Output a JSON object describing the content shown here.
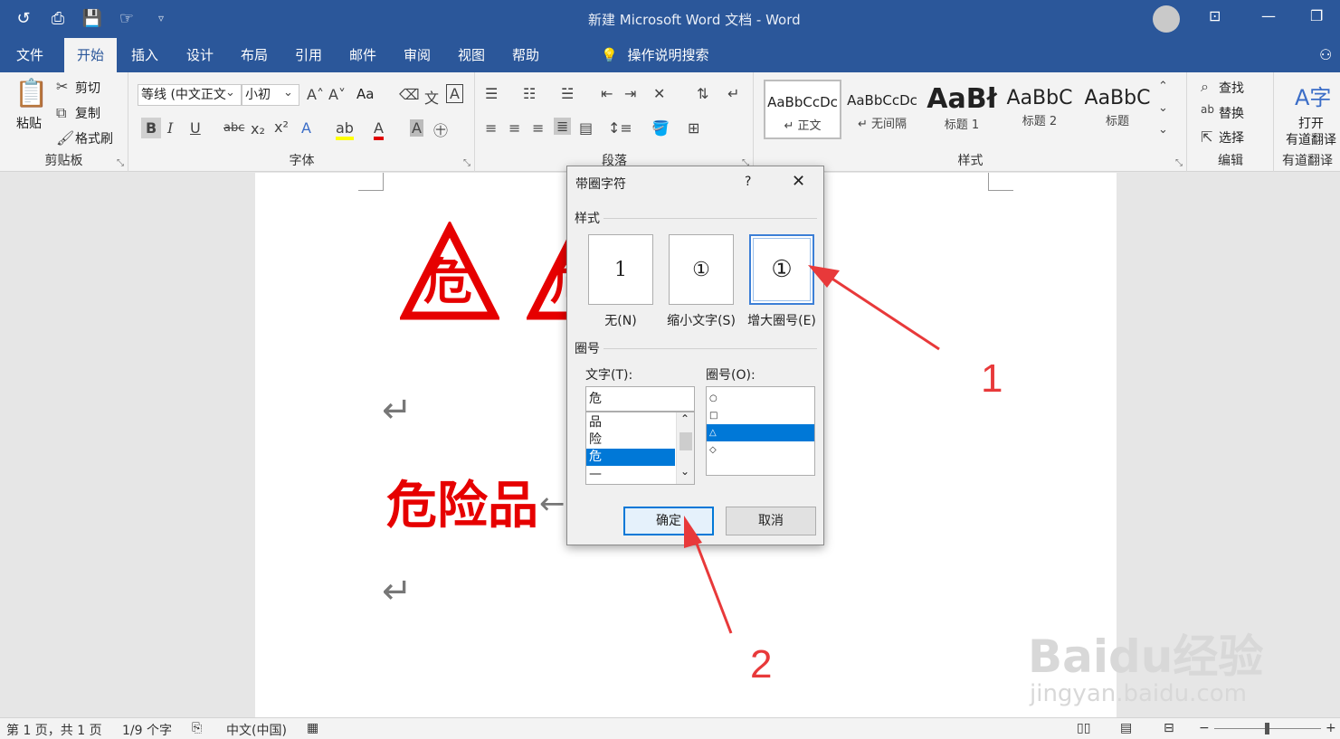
{
  "window": {
    "title": "新建 Microsoft Word 文档 - Word"
  },
  "tabs": [
    {
      "label": "文件"
    },
    {
      "label": "开始"
    },
    {
      "label": "插入"
    },
    {
      "label": "设计"
    },
    {
      "label": "布局"
    },
    {
      "label": "引用"
    },
    {
      "label": "邮件"
    },
    {
      "label": "审阅"
    },
    {
      "label": "视图"
    },
    {
      "label": "帮助"
    }
  ],
  "search": {
    "label": "操作说明搜索"
  },
  "ribbon": {
    "clipboard": {
      "label": "剪贴板",
      "paste": "粘贴",
      "cut": "剪切",
      "copy": "复制",
      "format_painter": "格式刷"
    },
    "font": {
      "label": "字体",
      "font_name": "等线 (中文正文",
      "font_size": "小初",
      "change_case": "Aa"
    },
    "paragraph": {
      "label": "段落"
    },
    "styles": {
      "label": "样式",
      "items": [
        {
          "sample": "AaBbCcDc",
          "name": "↵ 正文"
        },
        {
          "sample": "AaBbCcDc",
          "name": "↵ 无间隔"
        },
        {
          "sample": "AaBł",
          "name": "标题 1"
        },
        {
          "sample": "AaBbC",
          "name": "标题 2"
        },
        {
          "sample": "AaBbC",
          "name": "标题"
        }
      ]
    },
    "editing": {
      "label": "编辑",
      "find": "查找",
      "replace": "替换",
      "select": "选择"
    },
    "youdao": {
      "open": "打开",
      "translate": "有道翻译",
      "label": "有道翻译"
    }
  },
  "document": {
    "char": "危",
    "char2": "危",
    "heading": "危险品",
    "paragraph_mark": "↵"
  },
  "dialog": {
    "title": "带圈字符",
    "help": "?",
    "style_section": "样式",
    "options": [
      {
        "glyph": "1",
        "label": "无(N)"
      },
      {
        "glyph": "①",
        "label": "缩小文字(S)"
      },
      {
        "glyph": "①",
        "label": "增大圈号(E)"
      }
    ],
    "enclosure_section": "圈号",
    "text_label": "文字(T):",
    "text_value": "危",
    "text_list": [
      "品",
      "险",
      "危",
      "—"
    ],
    "enclosure_label": "圈号(O):",
    "enclosure_list": [
      "○",
      "□",
      "△",
      "◇"
    ],
    "ok": "确定",
    "cancel": "取消"
  },
  "status": {
    "page": "第 1 页，共 1 页",
    "words": "1/9 个字",
    "language": "中文(中国)"
  },
  "annotations": {
    "one": "1",
    "two": "2"
  },
  "watermark": {
    "brand": "Baidu经验",
    "url": "jingyan.baidu.com"
  }
}
